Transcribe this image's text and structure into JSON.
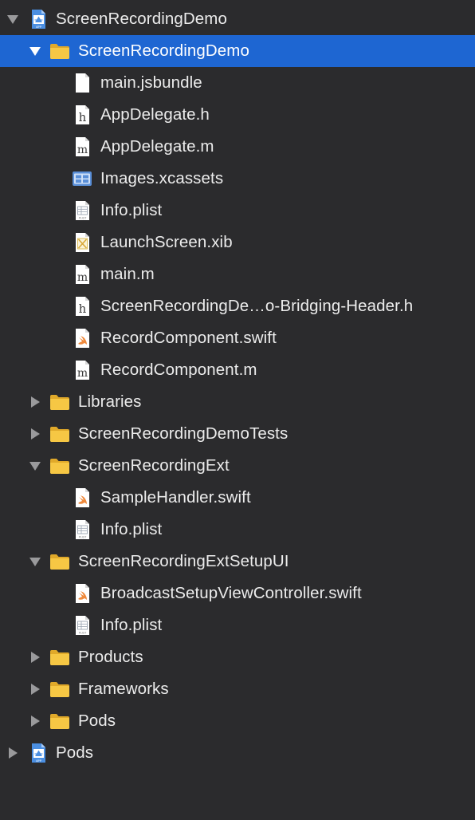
{
  "navigator": {
    "rows": [
      {
        "name": "project-screenrecordingdemo",
        "label": "ScreenRecordingDemo",
        "depth": 0,
        "icon": "xcode-project-icon",
        "disclosure": "expanded",
        "selected": false
      },
      {
        "name": "group-screenrecordingdemo",
        "label": "ScreenRecordingDemo",
        "depth": 1,
        "icon": "folder-icon",
        "disclosure": "expanded",
        "selected": true
      },
      {
        "name": "file-main-jsbundle",
        "label": "main.jsbundle",
        "depth": 2,
        "icon": "document-icon",
        "disclosure": "none",
        "selected": false
      },
      {
        "name": "file-appdelegate-h",
        "label": "AppDelegate.h",
        "depth": 2,
        "icon": "header-file-icon",
        "disclosure": "none",
        "selected": false
      },
      {
        "name": "file-appdelegate-m",
        "label": "AppDelegate.m",
        "depth": 2,
        "icon": "objc-file-icon",
        "disclosure": "none",
        "selected": false
      },
      {
        "name": "file-images-xcassets",
        "label": "Images.xcassets",
        "depth": 2,
        "icon": "asset-catalog-icon",
        "disclosure": "none",
        "selected": false
      },
      {
        "name": "file-info-plist-1",
        "label": "Info.plist",
        "depth": 2,
        "icon": "plist-file-icon",
        "disclosure": "none",
        "selected": false
      },
      {
        "name": "file-launchscreen-xib",
        "label": "LaunchScreen.xib",
        "depth": 2,
        "icon": "xib-file-icon",
        "disclosure": "none",
        "selected": false
      },
      {
        "name": "file-main-m",
        "label": "main.m",
        "depth": 2,
        "icon": "objc-file-icon",
        "disclosure": "none",
        "selected": false
      },
      {
        "name": "file-bridging-header-h",
        "label": "ScreenRecordingDe…o-Bridging-Header.h",
        "depth": 2,
        "icon": "header-file-icon",
        "disclosure": "none",
        "selected": false
      },
      {
        "name": "file-recordcomponent-swift",
        "label": "RecordComponent.swift",
        "depth": 2,
        "icon": "swift-file-icon",
        "disclosure": "none",
        "selected": false
      },
      {
        "name": "file-recordcomponent-m",
        "label": "RecordComponent.m",
        "depth": 2,
        "icon": "objc-file-icon",
        "disclosure": "none",
        "selected": false
      },
      {
        "name": "group-libraries",
        "label": "Libraries",
        "depth": 1,
        "icon": "folder-icon",
        "disclosure": "collapsed",
        "selected": false
      },
      {
        "name": "group-screenrecordingdemotests",
        "label": "ScreenRecordingDemoTests",
        "depth": 1,
        "icon": "folder-icon",
        "disclosure": "collapsed",
        "selected": false
      },
      {
        "name": "group-screenrecordingext",
        "label": "ScreenRecordingExt",
        "depth": 1,
        "icon": "folder-icon",
        "disclosure": "expanded",
        "selected": false
      },
      {
        "name": "file-samplehandler-swift",
        "label": "SampleHandler.swift",
        "depth": 2,
        "icon": "swift-file-icon",
        "disclosure": "none",
        "selected": false
      },
      {
        "name": "file-info-plist-2",
        "label": "Info.plist",
        "depth": 2,
        "icon": "plist-file-icon",
        "disclosure": "none",
        "selected": false
      },
      {
        "name": "group-screenrecordingextsetupui",
        "label": "ScreenRecordingExtSetupUI",
        "depth": 1,
        "icon": "folder-icon",
        "disclosure": "expanded",
        "selected": false
      },
      {
        "name": "file-broadcastsetupviewcontroller-swift",
        "label": "BroadcastSetupViewController.swift",
        "depth": 2,
        "icon": "swift-file-icon",
        "disclosure": "none",
        "selected": false
      },
      {
        "name": "file-info-plist-3",
        "label": "Info.plist",
        "depth": 2,
        "icon": "plist-file-icon",
        "disclosure": "none",
        "selected": false
      },
      {
        "name": "group-products",
        "label": "Products",
        "depth": 1,
        "icon": "folder-icon",
        "disclosure": "collapsed",
        "selected": false
      },
      {
        "name": "group-frameworks",
        "label": "Frameworks",
        "depth": 1,
        "icon": "folder-icon",
        "disclosure": "collapsed",
        "selected": false
      },
      {
        "name": "group-pods",
        "label": "Pods",
        "depth": 1,
        "icon": "folder-icon",
        "disclosure": "collapsed",
        "selected": false
      },
      {
        "name": "project-pods",
        "label": "Pods",
        "depth": 0,
        "icon": "xcode-project-icon",
        "disclosure": "collapsed",
        "selected": false
      }
    ]
  },
  "colors": {
    "background": "#2b2b2d",
    "selection": "#1e66d2",
    "text": "#ececec",
    "folder": "#f4c542",
    "disclosure": "#9a9a9c"
  }
}
